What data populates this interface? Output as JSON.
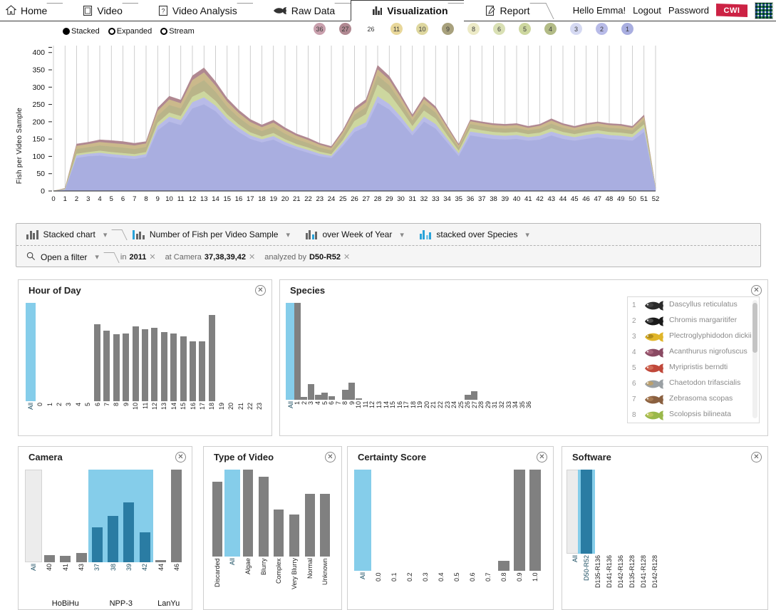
{
  "nav": {
    "tabs": [
      {
        "label": "Home",
        "icon": "home-icon",
        "active": false
      },
      {
        "label": "Video",
        "icon": "film-icon",
        "active": false
      },
      {
        "label": "Video Analysis",
        "icon": "analysis-icon",
        "active": false
      },
      {
        "label": "Raw Data",
        "icon": "fish-icon",
        "active": false
      },
      {
        "label": "Visualization",
        "icon": "bar-chart-icon",
        "active": true
      },
      {
        "label": "Report",
        "icon": "report-icon",
        "active": false
      }
    ],
    "greeting": "Hello Emma!",
    "logout": "Logout",
    "password": "Password",
    "cwi_logo": "CWI",
    "pixel_logo": "pixel-logo"
  },
  "chart_mode": {
    "options": [
      {
        "label": "Stacked",
        "selected": true
      },
      {
        "label": "Expanded",
        "selected": false
      },
      {
        "label": "Stream",
        "selected": false
      }
    ]
  },
  "legend_badges": [
    {
      "label": "36",
      "color": "#c9a0ad"
    },
    {
      "label": "27",
      "color": "#b08891"
    },
    {
      "label": "26",
      "color": "#ffffff"
    },
    {
      "label": "11",
      "color": "#e8d79a"
    },
    {
      "label": "10",
      "color": "#ded79f"
    },
    {
      "label": "9",
      "color": "#a8a17d"
    },
    {
      "label": "8",
      "color": "#eceac6"
    },
    {
      "label": "6",
      "color": "#d9e0b4"
    },
    {
      "label": "5",
      "color": "#cdd79f"
    },
    {
      "label": "4",
      "color": "#b2bb86"
    },
    {
      "label": "3",
      "color": "#d5d9f2"
    },
    {
      "label": "2",
      "color": "#b8bbe8"
    },
    {
      "label": "1",
      "color": "#a9aee0"
    }
  ],
  "chart_data": {
    "type": "area",
    "stacked": true,
    "title": "",
    "xlabel": "Week of Year",
    "ylabel": "Fish per Video Sample",
    "ylim": [
      0,
      420
    ],
    "yticks": [
      0,
      50,
      100,
      150,
      200,
      250,
      300,
      350,
      400
    ],
    "grid": true,
    "legend_position": "top",
    "x": [
      0,
      1,
      2,
      3,
      4,
      5,
      6,
      7,
      8,
      9,
      10,
      11,
      12,
      13,
      14,
      15,
      16,
      17,
      18,
      19,
      20,
      21,
      22,
      23,
      24,
      25,
      26,
      27,
      28,
      29,
      30,
      31,
      32,
      33,
      34,
      35,
      36,
      37,
      38,
      39,
      40,
      41,
      42,
      43,
      44,
      45,
      46,
      47,
      48,
      49,
      50,
      51,
      52
    ],
    "categories": [
      "0",
      "1",
      "2",
      "3",
      "4",
      "5",
      "6",
      "7",
      "8",
      "9",
      "10",
      "11",
      "12",
      "13",
      "14",
      "15",
      "16",
      "17",
      "18",
      "19",
      "20",
      "21",
      "22",
      "23",
      "24",
      "25",
      "26",
      "27",
      "28",
      "29",
      "30",
      "31",
      "32",
      "33",
      "34",
      "35",
      "36",
      "37",
      "38",
      "39",
      "40",
      "41",
      "42",
      "43",
      "44",
      "45",
      "46",
      "47",
      "48",
      "49",
      "50",
      "51",
      "52"
    ],
    "series": [
      {
        "name": "1",
        "color": "#a9aee0",
        "values": [
          0,
          2,
          95,
          100,
          102,
          98,
          95,
          92,
          98,
          175,
          200,
          190,
          238,
          250,
          230,
          195,
          170,
          150,
          140,
          148,
          132,
          120,
          110,
          100,
          95,
          130,
          170,
          185,
          255,
          235,
          200,
          160,
          200,
          180,
          140,
          100,
          160,
          155,
          150,
          148,
          150,
          145,
          148,
          160,
          150,
          145,
          150,
          155,
          150,
          148,
          145,
          170,
          5
        ]
      },
      {
        "name": "2",
        "color": "#b8bbe8",
        "values": [
          0,
          2,
          7,
          7,
          8,
          8,
          8,
          8,
          8,
          12,
          14,
          14,
          18,
          20,
          16,
          14,
          12,
          10,
          9,
          10,
          9,
          8,
          8,
          7,
          6,
          9,
          12,
          13,
          18,
          16,
          14,
          11,
          14,
          13,
          10,
          8,
          11,
          11,
          11,
          11,
          11,
          10,
          11,
          11,
          11,
          10,
          11,
          11,
          11,
          11,
          10,
          12,
          1
        ]
      },
      {
        "name": "4",
        "color": "#cdd79f",
        "values": [
          0,
          1,
          5,
          5,
          6,
          6,
          6,
          6,
          6,
          10,
          12,
          12,
          16,
          18,
          14,
          12,
          10,
          9,
          8,
          9,
          8,
          7,
          7,
          6,
          5,
          8,
          20,
          24,
          34,
          30,
          22,
          16,
          18,
          16,
          11,
          8,
          10,
          9,
          9,
          9,
          9,
          9,
          9,
          10,
          9,
          9,
          9,
          9,
          9,
          9,
          9,
          10,
          1
        ]
      },
      {
        "name": "9",
        "color": "#b9b489",
        "values": [
          0,
          1,
          14,
          14,
          15,
          16,
          16,
          15,
          15,
          20,
          22,
          22,
          28,
          32,
          26,
          22,
          20,
          18,
          16,
          18,
          16,
          14,
          13,
          12,
          11,
          14,
          18,
          20,
          26,
          24,
          20,
          16,
          20,
          17,
          13,
          9,
          12,
          12,
          12,
          12,
          12,
          11,
          12,
          13,
          12,
          11,
          12,
          12,
          12,
          12,
          11,
          13,
          1
        ]
      },
      {
        "name": "11",
        "color": "#cbb98b",
        "values": [
          0,
          1,
          9,
          9,
          10,
          10,
          10,
          10,
          10,
          14,
          16,
          15,
          20,
          22,
          18,
          15,
          13,
          12,
          11,
          12,
          11,
          10,
          9,
          8,
          7,
          9,
          12,
          14,
          18,
          16,
          13,
          10,
          13,
          11,
          9,
          6,
          8,
          8,
          8,
          8,
          8,
          7,
          8,
          9,
          8,
          7,
          8,
          8,
          8,
          8,
          7,
          9,
          1
        ]
      },
      {
        "name": "27",
        "color": "#b08891",
        "values": [
          0,
          1,
          6,
          6,
          7,
          8,
          8,
          7,
          6,
          9,
          10,
          10,
          13,
          14,
          12,
          10,
          9,
          8,
          7,
          8,
          7,
          6,
          6,
          5,
          5,
          6,
          8,
          9,
          12,
          11,
          9,
          7,
          8,
          7,
          6,
          4,
          5,
          5,
          5,
          5,
          5,
          5,
          5,
          6,
          5,
          5,
          5,
          5,
          5,
          5,
          5,
          6,
          1
        ]
      }
    ]
  },
  "controls": {
    "chart_type": {
      "label": "Stacked chart",
      "icon": "bar-chart-icon"
    },
    "measure": {
      "label": "Number of Fish per Video Sample",
      "icon": "measure-icon"
    },
    "over": {
      "label": "over Week of Year",
      "icon": "bar-chart-icon"
    },
    "stacked_over": {
      "label": "stacked over Species",
      "icon": "bar-chart-icon"
    },
    "open_filter": {
      "label": "Open a filter",
      "icon": "search-icon"
    },
    "active_filters": [
      {
        "prefix": "in",
        "value": "2011"
      },
      {
        "prefix": "at Camera",
        "value": "37,38,39,42"
      },
      {
        "prefix": "analyzed by",
        "value": "D50-R52"
      }
    ]
  },
  "panels": {
    "hour_of_day": {
      "title": "Hour of Day",
      "close": "✕",
      "categories": [
        "All",
        "0",
        "1",
        "2",
        "3",
        "4",
        "5",
        "6",
        "7",
        "8",
        "9",
        "10",
        "11",
        "12",
        "13",
        "14",
        "15",
        "16",
        "17",
        "18",
        "19",
        "20",
        "21",
        "22",
        "23"
      ],
      "values": [
        100,
        0,
        0,
        0,
        0,
        0,
        0,
        78,
        72,
        68,
        69,
        76,
        73,
        75,
        70,
        69,
        66,
        61,
        61,
        88,
        0,
        0,
        0,
        0,
        0
      ],
      "selected": [
        "All"
      ]
    },
    "species": {
      "title": "Species",
      "close": "✕",
      "categories": [
        "All",
        "1",
        "2",
        "3",
        "4",
        "5",
        "6",
        "7",
        "8",
        "9",
        "10",
        "11",
        "12",
        "13",
        "14",
        "15",
        "16",
        "17",
        "18",
        "19",
        "20",
        "21",
        "22",
        "23",
        "24",
        "25",
        "26",
        "27",
        "28",
        "29",
        "31",
        "32",
        "33",
        "34",
        "35",
        "36"
      ],
      "values": [
        100,
        100,
        3,
        16,
        5,
        7,
        4,
        0,
        10,
        18,
        1.5,
        0,
        0,
        0,
        0,
        0,
        0,
        0,
        0,
        0,
        0,
        0,
        0,
        0,
        0,
        0,
        5,
        9,
        0,
        0,
        0,
        0,
        0,
        0,
        0,
        0
      ],
      "selected": [
        "All"
      ],
      "legend": [
        {
          "num": "1",
          "name": "Dascyllus reticulatus",
          "fish": "fish-dark"
        },
        {
          "num": "2",
          "name": "Chromis margaritifer",
          "fish": "fish-black"
        },
        {
          "num": "3",
          "name": "Plectroglyphidodon dickii",
          "fish": "fish-yellow"
        },
        {
          "num": "4",
          "name": "Acanthurus nigrofuscus",
          "fish": "fish-purple"
        },
        {
          "num": "5",
          "name": "Myripristis berndti",
          "fish": "fish-red"
        },
        {
          "num": "6",
          "name": "Chaetodon trifascialis",
          "fish": "fish-grey"
        },
        {
          "num": "7",
          "name": "Zebrasoma scopas",
          "fish": "fish-brown"
        },
        {
          "num": "8",
          "name": "Scolopsis bilineata",
          "fish": "fish-green"
        }
      ]
    },
    "camera": {
      "title": "Camera",
      "close": "✕",
      "categories": [
        "All",
        "40",
        "41",
        "43",
        "37",
        "38",
        "39",
        "42",
        "44",
        "46"
      ],
      "values": [
        100,
        8,
        7,
        10,
        0,
        0,
        0,
        0,
        2,
        100
      ],
      "highlight_values": [
        0,
        0,
        0,
        0,
        38,
        50,
        65,
        32,
        0,
        0
      ],
      "selected": [
        "37",
        "38",
        "39",
        "42"
      ],
      "groups": [
        {
          "label": "HoBiHu",
          "span": [
            "40",
            "41",
            "43"
          ]
        },
        {
          "label": "NPP-3",
          "span": [
            "37",
            "38",
            "39",
            "42"
          ]
        },
        {
          "label": "LanYu",
          "span": [
            "44",
            "46"
          ]
        }
      ]
    },
    "type_of_video": {
      "title": "Type of Video",
      "close": "✕",
      "categories": [
        "Discarded",
        "All",
        "Algae",
        "Blurry",
        "Complex",
        "Very Blurry",
        "Normal",
        "Unknown"
      ],
      "values": [
        86,
        100,
        100,
        92,
        54,
        48,
        72,
        72
      ],
      "selected": [
        "All"
      ]
    },
    "certainty_score": {
      "title": "Certainty Score",
      "close": "✕",
      "categories": [
        "All",
        "0.0",
        "0.1",
        "0.2",
        "0.3",
        "0.4",
        "0.5",
        "0.6",
        "0.7",
        "0.8",
        "0.9",
        "1.0"
      ],
      "values": [
        100,
        0,
        0,
        0,
        0,
        0,
        0,
        0,
        0,
        10,
        100,
        100
      ],
      "selected": [
        "All"
      ]
    },
    "software": {
      "title": "Software",
      "close": "✕",
      "categories": [
        "All",
        "D50-R52",
        "D135-R136",
        "D141-R136",
        "D142-R136",
        "D135-R128",
        "D141-R128",
        "D142-R128"
      ],
      "values": [
        100,
        100,
        0,
        0,
        0,
        0,
        0,
        0
      ],
      "selected": [
        "D50-R52"
      ]
    }
  },
  "colors": {
    "selection_light": "#85cdea",
    "selection_dark": "#2a7ca3",
    "bar_grey": "#808080",
    "all_bar": "#ececec"
  }
}
